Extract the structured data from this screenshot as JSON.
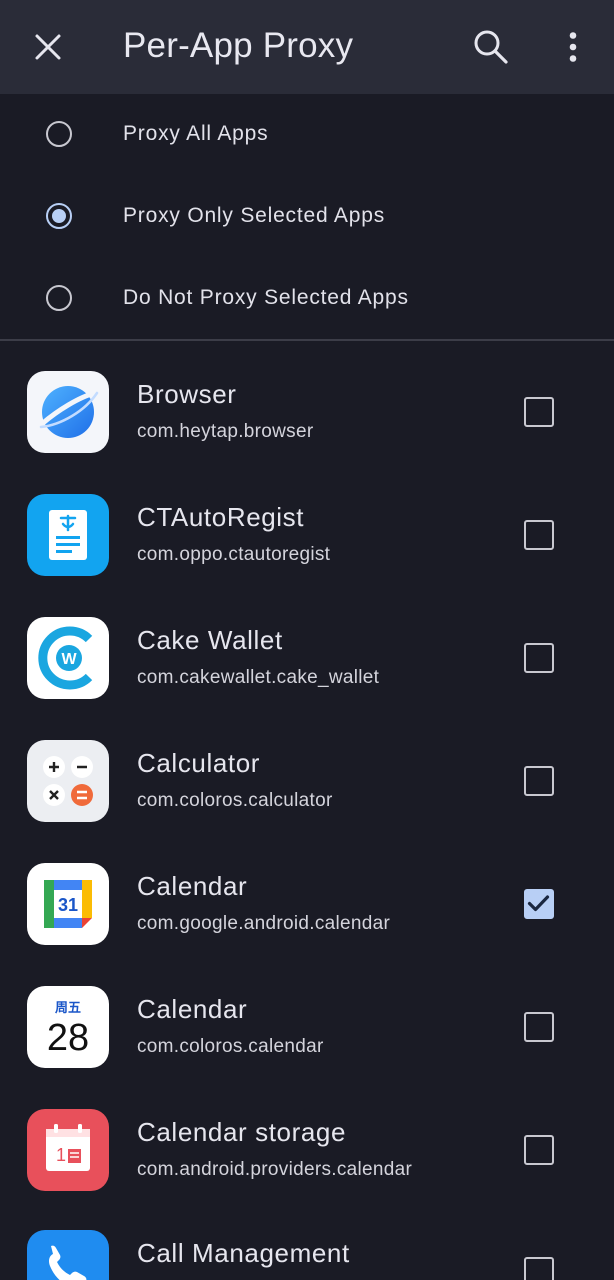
{
  "appbar": {
    "title": "Per-App Proxy",
    "close_icon": "close-icon",
    "search_icon": "search-icon",
    "more_icon": "more-vert-icon"
  },
  "proxy_mode": {
    "options": [
      {
        "label": "Proxy All Apps",
        "selected": false
      },
      {
        "label": "Proxy Only Selected Apps",
        "selected": true
      },
      {
        "label": "Do Not Proxy Selected Apps",
        "selected": false
      }
    ]
  },
  "apps": [
    {
      "name": "Browser",
      "package": "com.heytap.browser",
      "checked": false,
      "icon": "browser-planet-icon"
    },
    {
      "name": "CTAutoRegist",
      "package": "com.oppo.ctautoregist",
      "checked": false,
      "icon": "ctautoregist-document-icon"
    },
    {
      "name": "Cake Wallet",
      "package": "com.cakewallet.cake_wallet",
      "checked": false,
      "icon": "cake-wallet-icon"
    },
    {
      "name": "Calculator",
      "package": "com.coloros.calculator",
      "checked": false,
      "icon": "calculator-icon"
    },
    {
      "name": "Calendar",
      "package": "com.google.android.calendar",
      "checked": true,
      "icon": "google-calendar-icon",
      "icon_text": "31"
    },
    {
      "name": "Calendar",
      "package": "com.coloros.calendar",
      "checked": false,
      "icon": "coloros-calendar-icon",
      "icon_weekday": "周五",
      "icon_day": "28"
    },
    {
      "name": "Calendar storage",
      "package": "com.android.providers.calendar",
      "checked": false,
      "icon": "calendar-storage-icon",
      "icon_text": "1"
    },
    {
      "name": "Call Management",
      "package": "",
      "checked": false,
      "icon": "phone-icon"
    }
  ],
  "colors": {
    "background": "#1a1b25",
    "appbar": "#2a2c38",
    "accent": "#b8cff5",
    "divider": "#3c3d48"
  }
}
